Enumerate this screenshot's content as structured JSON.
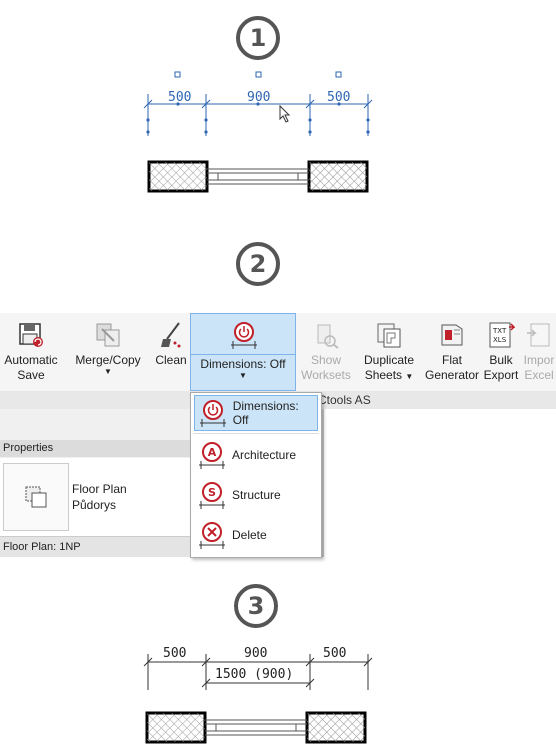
{
  "steps": {
    "one": "1",
    "two": "2",
    "three": "3"
  },
  "top_dims": {
    "left": "500",
    "mid": "900",
    "right": "500"
  },
  "bottom_dims": {
    "left": "500",
    "mid": "900",
    "right": "500",
    "total": "1500 (900)"
  },
  "ribbon": {
    "automatic_save": [
      "Automatic",
      "Save"
    ],
    "merge_copy": "Merge/Copy",
    "clean": "Clean",
    "dimensions": "Dimensions: Off",
    "show_worksets": [
      "Show",
      "Worksets"
    ],
    "duplicate_sheets": [
      "Duplicate",
      "Sheets"
    ],
    "flat_generator": [
      "Flat",
      "Generator"
    ],
    "bulk_export": [
      "Bulk",
      "Export"
    ],
    "import_excel": [
      "Impor",
      "Excel"
    ],
    "txt_label": "TXT",
    "xls_label": "XLS",
    "panel_label": "Ctools AS"
  },
  "properties": {
    "title": "Properties",
    "type_line1": "Floor Plan",
    "type_line2": "Půdorys",
    "instance": "Floor Plan: 1NP"
  },
  "menu": {
    "items": [
      "Dimensions: Off",
      "Architecture",
      "Structure",
      "Delete"
    ],
    "letters": {
      "arch": "A",
      "struct": "S"
    }
  },
  "colors": {
    "accent_blue": "#2f66b3",
    "menu_red": "#c0202a",
    "highlight": "#cce4f7"
  }
}
